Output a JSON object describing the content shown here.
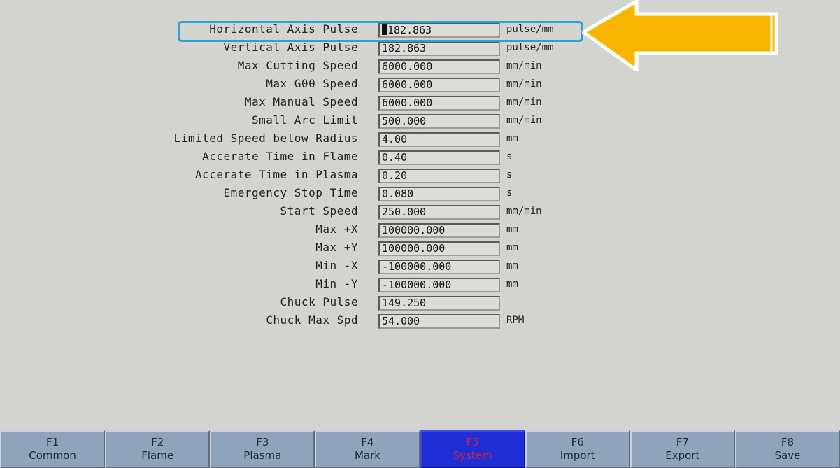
{
  "parameters": [
    {
      "label": "Horizontal Axis Pulse",
      "value": "182.863",
      "unit": "pulse/mm"
    },
    {
      "label": "Vertical Axis Pulse",
      "value": "182.863",
      "unit": "pulse/mm"
    },
    {
      "label": "Max Cutting Speed",
      "value": "6000.000",
      "unit": "mm/min"
    },
    {
      "label": "Max G00 Speed",
      "value": "6000.000",
      "unit": "mm/min"
    },
    {
      "label": "Max Manual Speed",
      "value": "6000.000",
      "unit": "mm/min"
    },
    {
      "label": "Small Arc Limit",
      "value": "500.000",
      "unit": "mm/min"
    },
    {
      "label": "Limited Speed below Radius",
      "value": "4.00",
      "unit": "mm"
    },
    {
      "label": "Accerate Time in Flame",
      "value": "0.40",
      "unit": "s"
    },
    {
      "label": "Accerate Time in Plasma",
      "value": "0.20",
      "unit": "s"
    },
    {
      "label": "Emergency Stop Time",
      "value": "0.080",
      "unit": "s"
    },
    {
      "label": "Start Speed",
      "value": "250.000",
      "unit": "mm/min"
    },
    {
      "label": "Max +X",
      "value": "100000.000",
      "unit": "mm"
    },
    {
      "label": "Max +Y",
      "value": "100000.000",
      "unit": "mm"
    },
    {
      "label": "Min -X",
      "value": "-100000.000",
      "unit": "mm"
    },
    {
      "label": "Min -Y",
      "value": "-100000.000",
      "unit": "mm"
    },
    {
      "label": "Chuck Pulse",
      "value": "149.250",
      "unit": ""
    },
    {
      "label": "Chuck Max Spd",
      "value": "54.000",
      "unit": "RPM"
    }
  ],
  "function_keys": [
    {
      "key": "F1",
      "label": "Common"
    },
    {
      "key": "F2",
      "label": "Flame"
    },
    {
      "key": "F3",
      "label": "Plasma"
    },
    {
      "key": "F4",
      "label": "Mark"
    },
    {
      "key": "F5",
      "label": "System"
    },
    {
      "key": "F6",
      "label": "Import"
    },
    {
      "key": "F7",
      "label": "Export"
    },
    {
      "key": "F8",
      "label": "Save"
    }
  ],
  "active_function_key": "F5",
  "colors": {
    "highlight_border": "#2a9fd8",
    "arrow_fill": "#f7b500",
    "active_key_bg": "#1f2fd6",
    "active_key_text": "#d9203a",
    "key_bg": "#8fa3ba"
  },
  "annotation": {
    "icon": "arrow-left-icon",
    "highlighted_row": 0
  }
}
